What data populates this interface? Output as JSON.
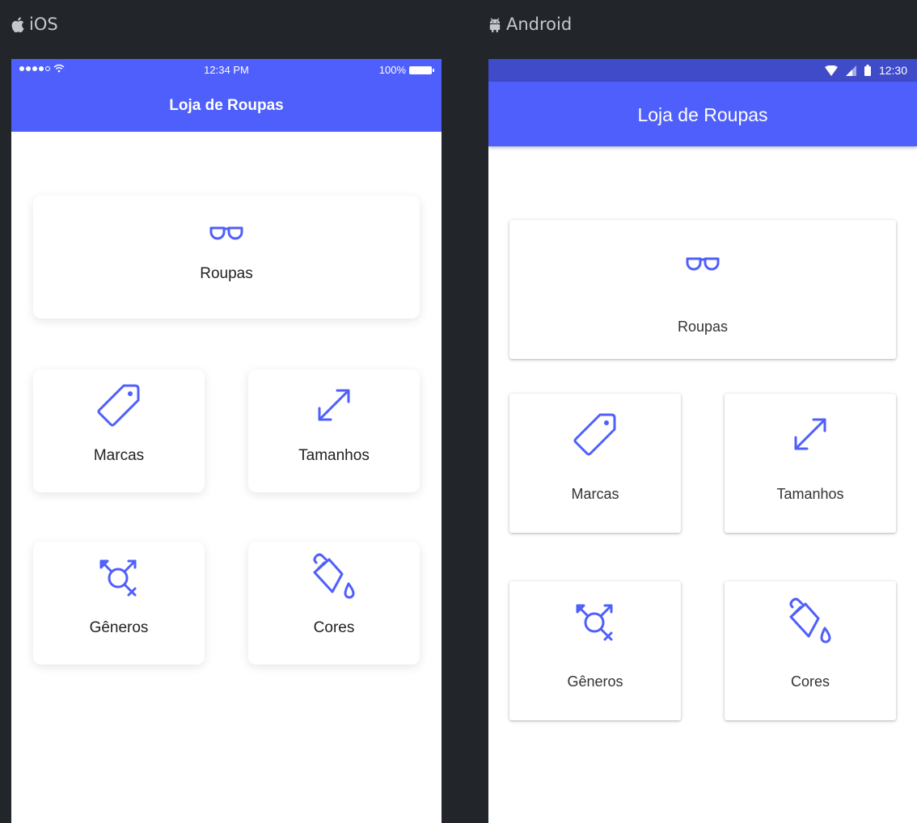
{
  "platforms": {
    "ios": {
      "label": "iOS",
      "status_time": "12:34 PM",
      "status_battery": "100%",
      "title": "Loja de Roupas"
    },
    "android": {
      "label": "Android",
      "status_time": "12:30",
      "title": "Loja de Roupas"
    }
  },
  "menu": [
    {
      "label": "Roupas",
      "icon": "glasses-icon"
    },
    {
      "label": "Marcas",
      "icon": "tag-icon"
    },
    {
      "label": "Tamanhos",
      "icon": "resize-arrow-icon"
    },
    {
      "label": "Gêneros",
      "icon": "gender-icon"
    },
    {
      "label": "Cores",
      "icon": "paint-bucket-icon"
    }
  ],
  "colors": {
    "accent": "#4f5ffb",
    "android_status_bar": "#3f4bc9",
    "background": "#22262b"
  }
}
